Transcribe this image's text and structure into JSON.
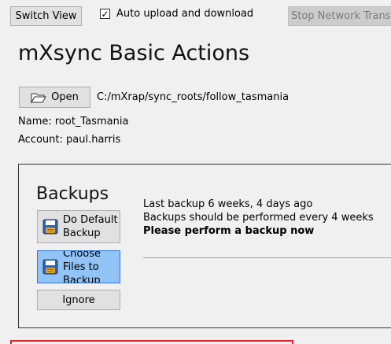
{
  "toolbar": {
    "switch_view_label": "Switch View",
    "auto_upload_label": "Auto upload and download",
    "auto_upload_checked": true,
    "stop_transfer_label": "Stop Network Transfer"
  },
  "title": "mXsync Basic Actions",
  "sync_root": {
    "open_label": "Open",
    "path": "C:/mXrap/sync_roots/follow_tasmania",
    "name_line": "Name: root_Tasmania",
    "account_line": "Account: paul.harris"
  },
  "backups": {
    "title": "Backups",
    "default_backup_label": "Do Default Backup",
    "choose_files_label": "Choose Files to Backup",
    "ignore_label": "Ignore",
    "last_backup": "Last backup 6 weeks, 4 days ago",
    "frequency": "Backups should be performed every 4 weeks",
    "urgent": "Please perform a backup now"
  },
  "colors": {
    "accent_button": "#91c3f7",
    "alert_border": "#d9262d"
  },
  "icons": [
    "checkbox-checked",
    "folder-open-icon",
    "floppy-save-icon"
  ]
}
